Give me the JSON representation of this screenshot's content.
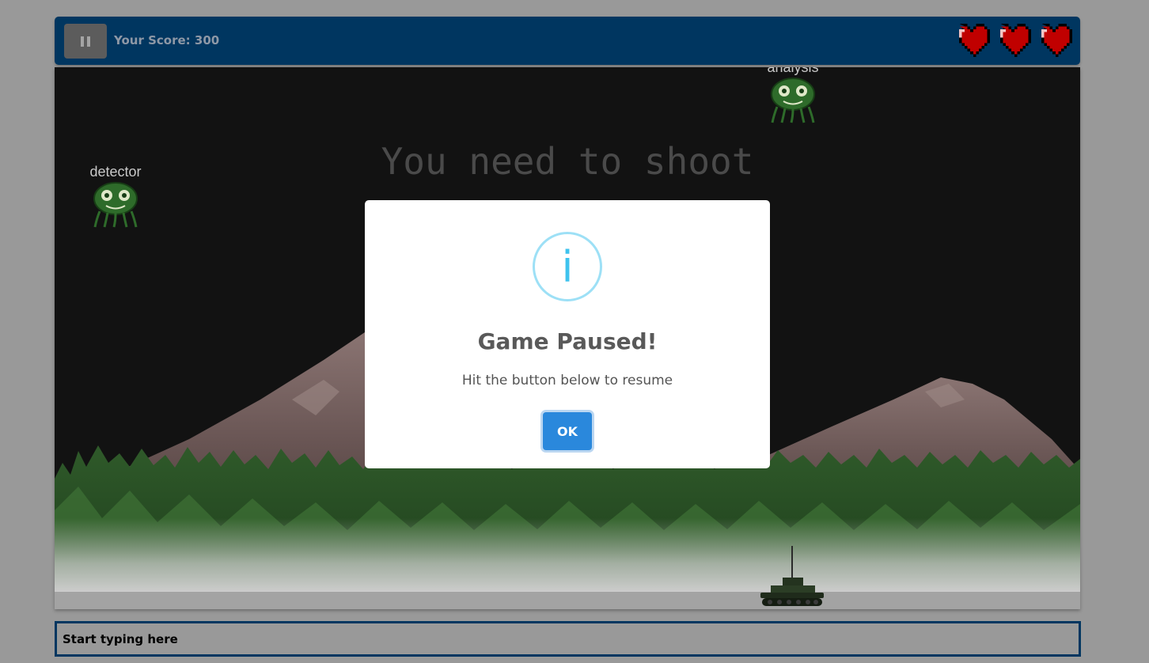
{
  "header": {
    "pause_label": "Pause",
    "score_label": "Your Score: 300",
    "hearts": [
      "heart-icon",
      "heart-icon",
      "heart-icon"
    ],
    "colors": {
      "bar": "#003660",
      "heart": "#c00000"
    }
  },
  "game": {
    "instruction": "You need to shoot",
    "enemies": [
      {
        "word": "detector"
      },
      {
        "word": "analysis"
      }
    ],
    "player": "tank"
  },
  "modal": {
    "icon": "info-icon",
    "icon_glyph": "i",
    "title": "Game Paused!",
    "text": "Hit the button below to resume",
    "ok_label": "OK",
    "colors": {
      "button": "#2a88dc",
      "icon": "#3fc3ee"
    }
  },
  "input": {
    "placeholder": "Start typing here"
  }
}
